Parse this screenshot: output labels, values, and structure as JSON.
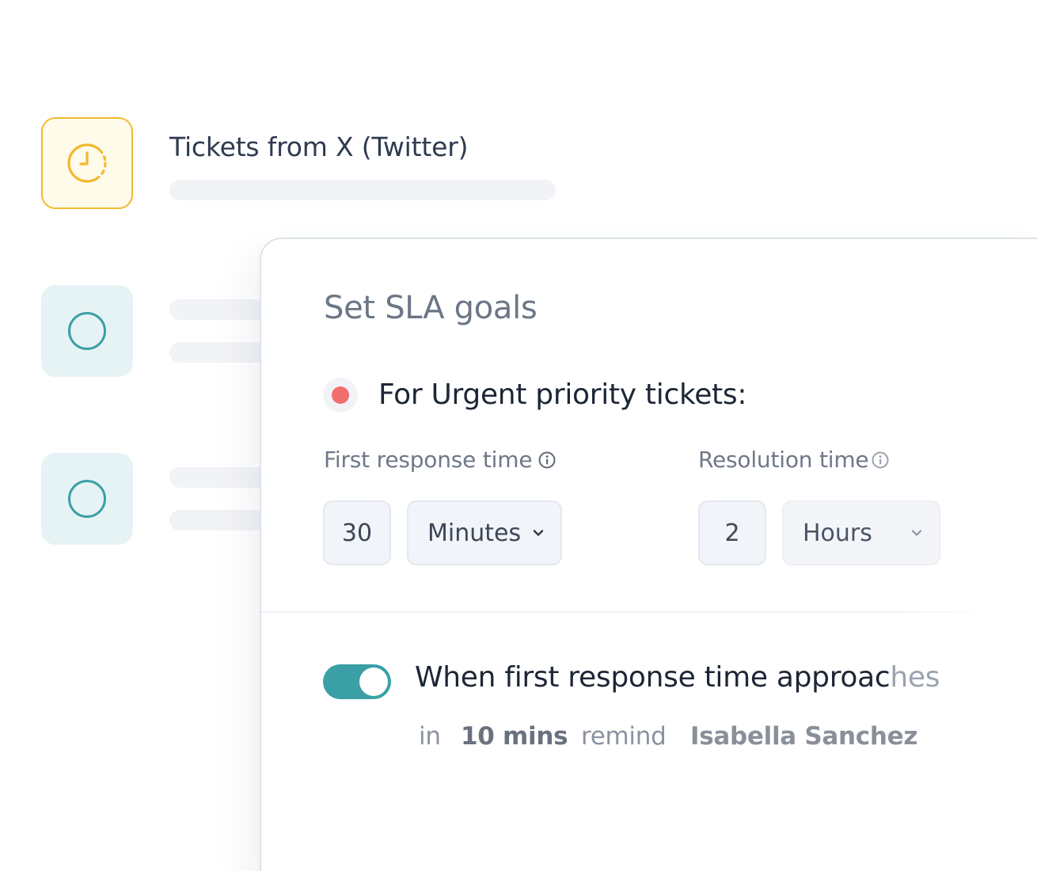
{
  "list": {
    "row1_title": "Tickets from X (Twitter)",
    "row1_icon": "timer-icon",
    "row2_icon": "circle-icon",
    "row3_icon": "circle-icon"
  },
  "card": {
    "title": "Set SLA goals",
    "priority_heading": "For Urgent priority tickets:",
    "priority_color": "#f26d6d",
    "first_response": {
      "label": "First response time",
      "value": "30",
      "unit": "Minutes"
    },
    "resolution": {
      "label": "Resolution time",
      "value": "2",
      "unit": "Hours"
    },
    "reminder": {
      "toggle_on": true,
      "heading_main": "When first response time approac",
      "heading_fade": "hes",
      "in": "in",
      "duration": "10 mins",
      "remind": "remind",
      "assignee": "Isabella Sanchez"
    }
  },
  "colors": {
    "accent_teal": "#3aa0a6",
    "accent_yellow": "#f2b92e",
    "urgent_red": "#f26d6d"
  }
}
